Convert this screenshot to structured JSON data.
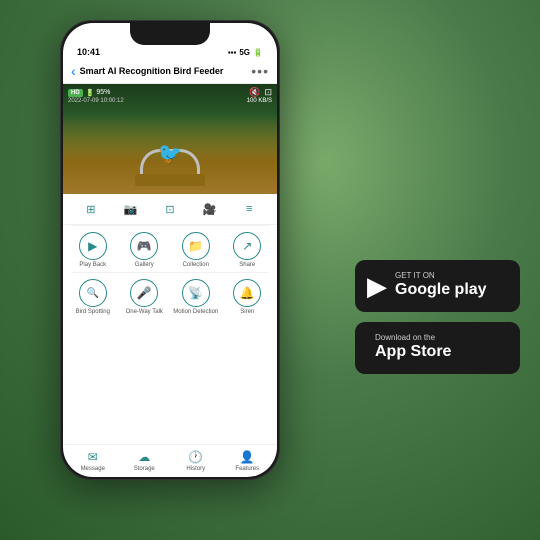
{
  "background": {
    "color_top": "#6aaa5a",
    "color_bottom": "#3a6a3a"
  },
  "phone": {
    "status_bar": {
      "time": "10:41",
      "signal": "●●●",
      "network": "5G",
      "battery": "■"
    },
    "header": {
      "back_label": "‹",
      "title": "Smart AI Recognition Bird Feeder",
      "more_label": "•••"
    },
    "video": {
      "hd_badge": "HD",
      "battery_percent": "95%",
      "timestamp": "2022-07-09  10:00:12",
      "speed": "100 KB/S"
    },
    "controls": [
      "⊞",
      "📷",
      "⊡",
      "🎥",
      "≡"
    ],
    "actions_row1": [
      {
        "icon": "▶",
        "label": "Play Back"
      },
      {
        "icon": "🎮",
        "label": "Gallery"
      },
      {
        "icon": "📁",
        "label": "Collection"
      },
      {
        "icon": "↗",
        "label": "Share"
      }
    ],
    "actions_row2": [
      {
        "icon": "🔍",
        "label": "Bird Spotting"
      },
      {
        "icon": "🎤",
        "label": "One-Way Talk"
      },
      {
        "icon": "📡",
        "label": "Motion Detection"
      },
      {
        "icon": "🔔",
        "label": "Siren"
      }
    ],
    "bottom_nav": [
      {
        "icon": "✉",
        "label": "Message"
      },
      {
        "icon": "☁",
        "label": "Storage"
      },
      {
        "icon": "🕐",
        "label": "History"
      },
      {
        "icon": "👤",
        "label": "Features"
      }
    ]
  },
  "store_buttons": {
    "google_play": {
      "sub_label": "GET IT ON",
      "name_label": "Google play",
      "icon": "▶"
    },
    "app_store": {
      "sub_label": "Download on the",
      "name_label": "App Store",
      "icon": ""
    }
  }
}
